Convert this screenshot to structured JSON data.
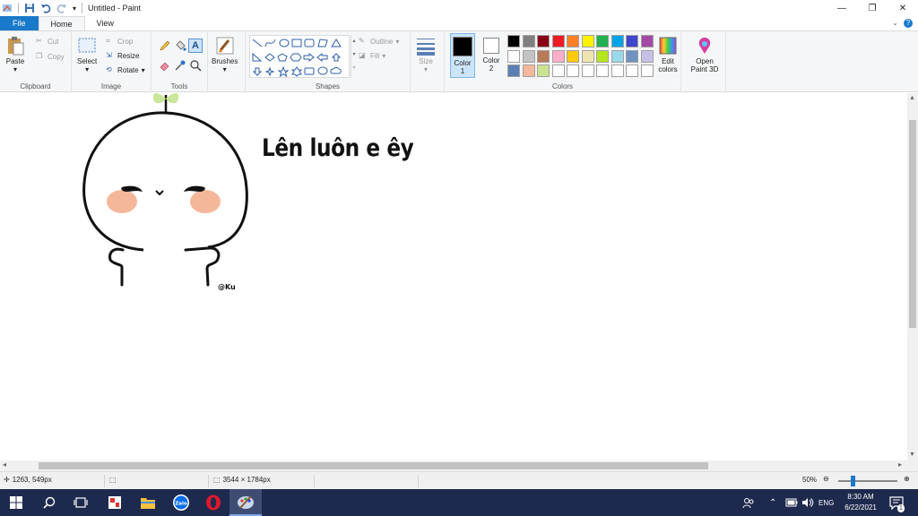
{
  "window": {
    "title": "Untitled - Paint"
  },
  "menu": {
    "file": "File",
    "home": "Home",
    "view": "View"
  },
  "ribbon": {
    "clipboard": {
      "paste": "Paste",
      "cut": "Cut",
      "copy": "Copy",
      "label": "Clipboard"
    },
    "image": {
      "select": "Select",
      "crop": "Crop",
      "resize": "Resize",
      "rotate": "Rotate",
      "label": "Image"
    },
    "tools": {
      "label": "Tools"
    },
    "brushes": {
      "label": "Brushes"
    },
    "shapes": {
      "outline": "Outline",
      "fill": "Fill",
      "label": "Shapes"
    },
    "size": {
      "label": "Size"
    },
    "colors": {
      "color1_label": "Color\n1",
      "color2_label": "Color\n2",
      "color1": "#000000",
      "color2": "#ffffff",
      "edit_colors": "Edit colors",
      "label": "Colors",
      "palette_row1": [
        "#000000",
        "#7f7f7f",
        "#880015",
        "#ed1c24",
        "#ff7f27",
        "#fff200",
        "#22b14c",
        "#00a2e8",
        "#3f48cc",
        "#a349a4"
      ],
      "palette_row2": [
        "#ffffff",
        "#c3c3c3",
        "#b97a57",
        "#ffaec9",
        "#ffc90e",
        "#efe4b0",
        "#b5e61d",
        "#99d9ea",
        "#7092be",
        "#c8bfe7"
      ],
      "palette_row3": [
        "#5b7fb5",
        "#f5b79a",
        "#cbe38f",
        "#ffffff",
        "#ffffff",
        "#ffffff",
        "#ffffff",
        "#ffffff",
        "#ffffff",
        "#ffffff"
      ]
    },
    "paint3d": {
      "label": "Open Paint 3D"
    }
  },
  "canvas": {
    "caption": "Lên luôn e êy",
    "signature": "@Ku"
  },
  "status": {
    "cursor_pos": "1263, 549px",
    "image_size": "3544 × 1784px",
    "zoom": "50%",
    "zoom_level": 0.5
  },
  "taskbar": {
    "lang": "ENG",
    "time": "8:30 AM",
    "date": "6/22/2021",
    "notification_count": "1"
  }
}
